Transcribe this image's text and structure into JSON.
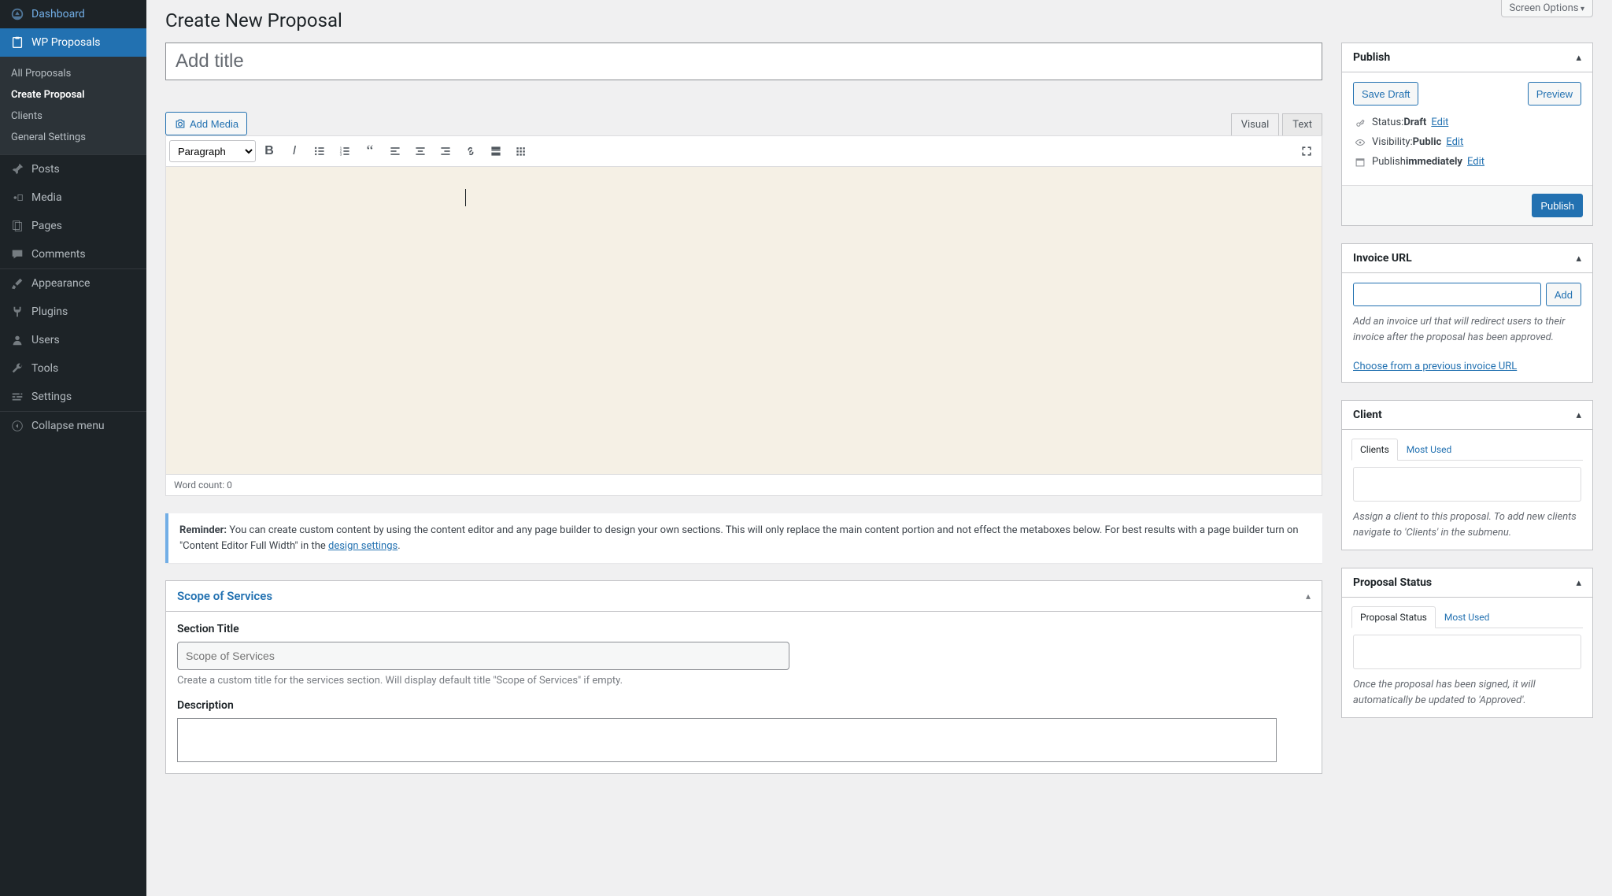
{
  "screen_options": "Screen Options",
  "page_title": "Create New Proposal",
  "title_placeholder": "Add title",
  "sidebar": {
    "items": [
      {
        "label": "Dashboard",
        "icon": "dashboard"
      },
      {
        "label": "WP Proposals",
        "icon": "clipboard",
        "current": true,
        "submenu": [
          {
            "label": "All Proposals"
          },
          {
            "label": "Create Proposal",
            "current": true
          },
          {
            "label": "Clients"
          },
          {
            "label": "General Settings"
          }
        ]
      },
      {
        "label": "Posts",
        "icon": "pin"
      },
      {
        "label": "Media",
        "icon": "media"
      },
      {
        "label": "Pages",
        "icon": "pages"
      },
      {
        "label": "Comments",
        "icon": "comments"
      },
      {
        "label": "Appearance",
        "icon": "brush",
        "section": true
      },
      {
        "label": "Plugins",
        "icon": "plug"
      },
      {
        "label": "Users",
        "icon": "user"
      },
      {
        "label": "Tools",
        "icon": "wrench"
      },
      {
        "label": "Settings",
        "icon": "sliders"
      },
      {
        "label": "Collapse menu",
        "icon": "collapse",
        "section": true
      }
    ]
  },
  "add_media": "Add Media",
  "editor": {
    "tabs": {
      "visual": "Visual",
      "text": "Text"
    },
    "format": "Paragraph",
    "word_count": "Word count: 0"
  },
  "reminder": {
    "prefix": "Reminder:",
    "body": " You can create custom content by using the content editor and any page builder to design your own sections. This will only replace the main content portion and not effect the metaboxes below. For best results with a page builder turn on \"Content Editor Full Width\" in the ",
    "link": "design settings",
    "suffix": "."
  },
  "scope": {
    "title": "Scope of Services",
    "section_title_label": "Section Title",
    "section_title_placeholder": "Scope of Services",
    "section_title_help": "Create a custom title for the services section. Will display default title \"Scope of Services\" if empty.",
    "description_label": "Description"
  },
  "publish": {
    "title": "Publish",
    "save_draft": "Save Draft",
    "preview": "Preview",
    "status_label": "Status: ",
    "status_value": "Draft",
    "visibility_label": "Visibility: ",
    "visibility_value": "Public",
    "publish_label": "Publish ",
    "publish_value": "immediately",
    "edit": "Edit",
    "button": "Publish"
  },
  "invoice": {
    "title": "Invoice URL",
    "add": "Add",
    "hint": "Add an invoice url that will redirect users to their invoice after the proposal has been approved.",
    "choose": "Choose from a previous invoice URL"
  },
  "client": {
    "title": "Client",
    "tabs": {
      "clients": "Clients",
      "most_used": "Most Used"
    },
    "hint": "Assign a client to this proposal. To add new clients navigate to 'Clients' in the submenu."
  },
  "status": {
    "title": "Proposal Status",
    "tabs": {
      "status": "Proposal Status",
      "most_used": "Most Used"
    },
    "hint": "Once the proposal has been signed, it will automatically be updated to 'Approved'."
  }
}
